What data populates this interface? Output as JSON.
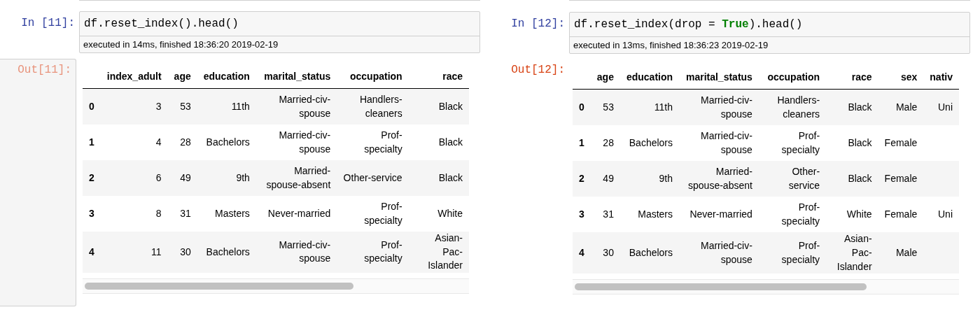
{
  "cells": [
    {
      "input_prompt": "In [11]:",
      "code": [
        {
          "kind": "plain",
          "text": "df.reset_index().head()"
        }
      ],
      "timing": "executed in 14ms, finished 18:36:20 2019-02-19",
      "output_prompt": "Out[11]:",
      "prompt_highlighted": true,
      "table": {
        "columns": [
          "index_adult",
          "age",
          "education",
          "marital_status",
          "occupation",
          "race"
        ],
        "rows": [
          {
            "index": "0",
            "values": {
              "index_adult": "3",
              "age": "53",
              "education": "11th",
              "marital_status": "Married-civ-spouse",
              "occupation": "Handlers-cleaners",
              "race": "Black"
            }
          },
          {
            "index": "1",
            "values": {
              "index_adult": "4",
              "age": "28",
              "education": "Bachelors",
              "marital_status": "Married-civ-spouse",
              "occupation": "Prof-specialty",
              "race": "Black"
            }
          },
          {
            "index": "2",
            "values": {
              "index_adult": "6",
              "age": "49",
              "education": "9th",
              "marital_status": "Married-spouse-absent",
              "occupation": "Other-service",
              "race": "Black"
            }
          },
          {
            "index": "3",
            "values": {
              "index_adult": "8",
              "age": "31",
              "education": "Masters",
              "marital_status": "Never-married",
              "occupation": "Prof-specialty",
              "race": "White"
            }
          },
          {
            "index": "4",
            "values": {
              "index_adult": "11",
              "age": "30",
              "education": "Bachelors",
              "marital_status": "Married-civ-spouse",
              "occupation": "Prof-specialty",
              "race": "Asian-Pac-Islander"
            }
          }
        ]
      }
    },
    {
      "input_prompt": "In [12]:",
      "code": [
        {
          "kind": "plain",
          "text": "df.reset_index(drop = "
        },
        {
          "kind": "keyword",
          "text": "True"
        },
        {
          "kind": "plain",
          "text": ").head()"
        }
      ],
      "timing": "executed in 13ms, finished 18:36:23 2019-02-19",
      "output_prompt": "Out[12]:",
      "prompt_highlighted": false,
      "table": {
        "columns": [
          "age",
          "education",
          "marital_status",
          "occupation",
          "race",
          "sex",
          "nativ"
        ],
        "rows": [
          {
            "index": "0",
            "values": {
              "age": "53",
              "education": "11th",
              "marital_status": "Married-civ-spouse",
              "occupation": "Handlers-cleaners",
              "race": "Black",
              "sex": "Male",
              "nativ": "Uni"
            }
          },
          {
            "index": "1",
            "values": {
              "age": "28",
              "education": "Bachelors",
              "marital_status": "Married-civ-spouse",
              "occupation": "Prof-specialty",
              "race": "Black",
              "sex": "Female"
            }
          },
          {
            "index": "2",
            "values": {
              "age": "49",
              "education": "9th",
              "marital_status": "Married-spouse-absent",
              "occupation": "Other-service",
              "race": "Black",
              "sex": "Female"
            }
          },
          {
            "index": "3",
            "values": {
              "age": "31",
              "education": "Masters",
              "marital_status": "Never-married",
              "occupation": "Prof-specialty",
              "race": "White",
              "sex": "Female",
              "nativ": "Uni"
            }
          },
          {
            "index": "4",
            "values": {
              "age": "30",
              "education": "Bachelors",
              "marital_status": "Married-civ-spouse",
              "occupation": "Prof-specialty",
              "race": "Asian-Pac-Islander",
              "sex": "Male"
            }
          }
        ]
      }
    }
  ]
}
